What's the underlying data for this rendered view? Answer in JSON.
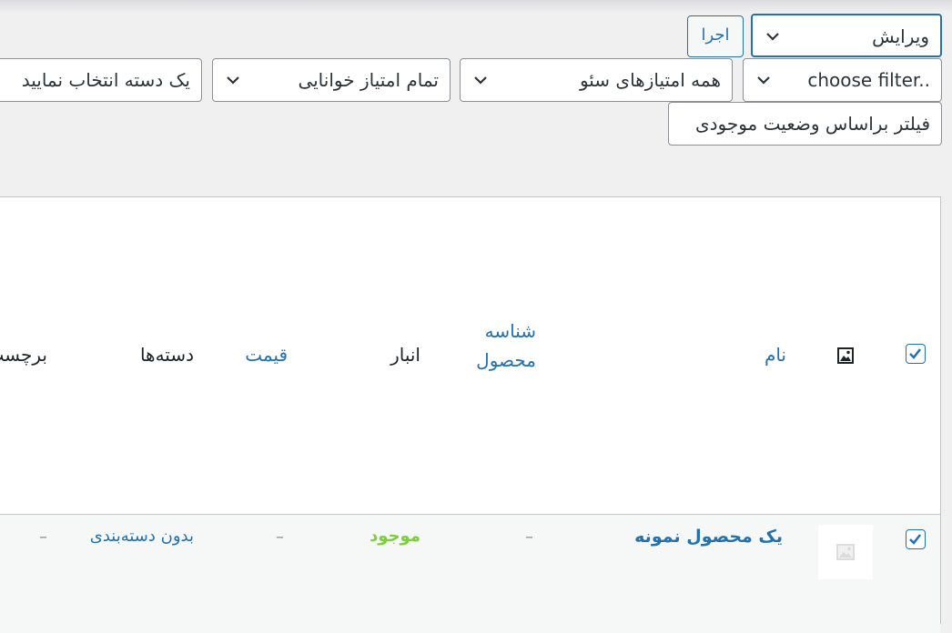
{
  "bulk_actions": {
    "selected": "ویرایش",
    "apply_label": "اجرا"
  },
  "filters": {
    "choose_filter": "choose filter..",
    "seo_scores": "همه امتیازهای سئو",
    "readability": "تمام امتیاز خوانایی",
    "category": "یک دسته انتخاب نمایید",
    "stock_status": "فیلتر براساس وضعیت موجودی"
  },
  "table": {
    "columns": {
      "name": "نام",
      "sku_line1": "شناسه",
      "sku_line2": "محصول",
      "stock": "انبار",
      "price": "قیمت",
      "categories": "دسته‌ها",
      "tags": "برچسب‌ها"
    },
    "rows": [
      {
        "name": "یک محصول نمونه",
        "sku": "–",
        "stock": "موجود",
        "price": "–",
        "categories": "بدون دسته‌بندی",
        "tags": "–"
      }
    ]
  },
  "colors": {
    "accent": "#2271b1",
    "in_stock": "#7ad03a",
    "text": "#1d2327",
    "border": "#8c8f94"
  }
}
